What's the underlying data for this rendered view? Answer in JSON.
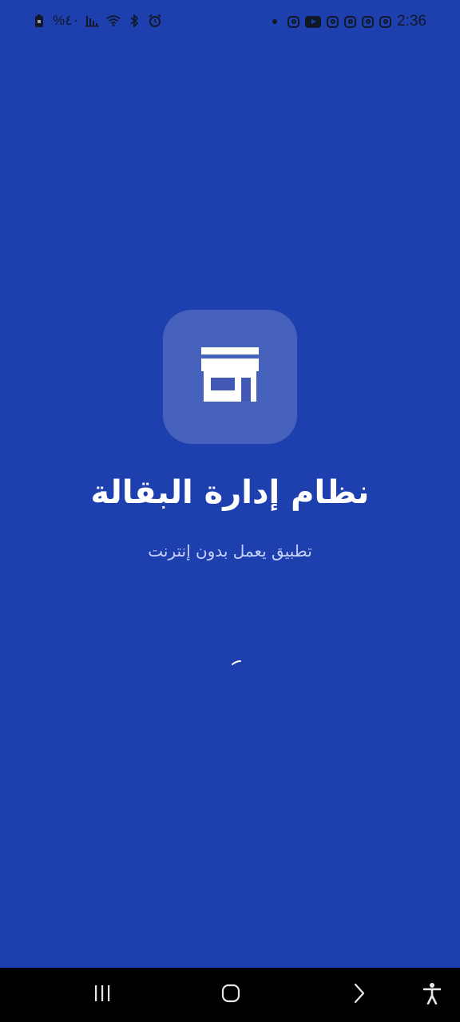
{
  "status_bar": {
    "left_text": "%٤٠",
    "time": "2:36",
    "left_icons": [
      "battery-lock-icon",
      "signal-icon",
      "wifi-icon",
      "bluetooth-icon",
      "alarm-icon"
    ],
    "right_icons": [
      "notification-dot-icon",
      "instagram-icon",
      "youtube-icon",
      "instagram-icon",
      "instagram-icon",
      "instagram-icon",
      "instagram-icon"
    ]
  },
  "app": {
    "title": "نظام إدارة البقالة",
    "subtitle": "تطبيق يعمل بدون إنترنت",
    "logo_icon": "store-icon"
  },
  "nav_bar": {
    "buttons": [
      "recent-apps-icon",
      "home-icon",
      "back-icon",
      "accessibility-icon"
    ]
  },
  "colors": {
    "background": "#1e40af",
    "logo_bg": "rgba(255,255,255,0.18)",
    "title": "#ffffff",
    "subtitle": "#c7d2fe"
  }
}
